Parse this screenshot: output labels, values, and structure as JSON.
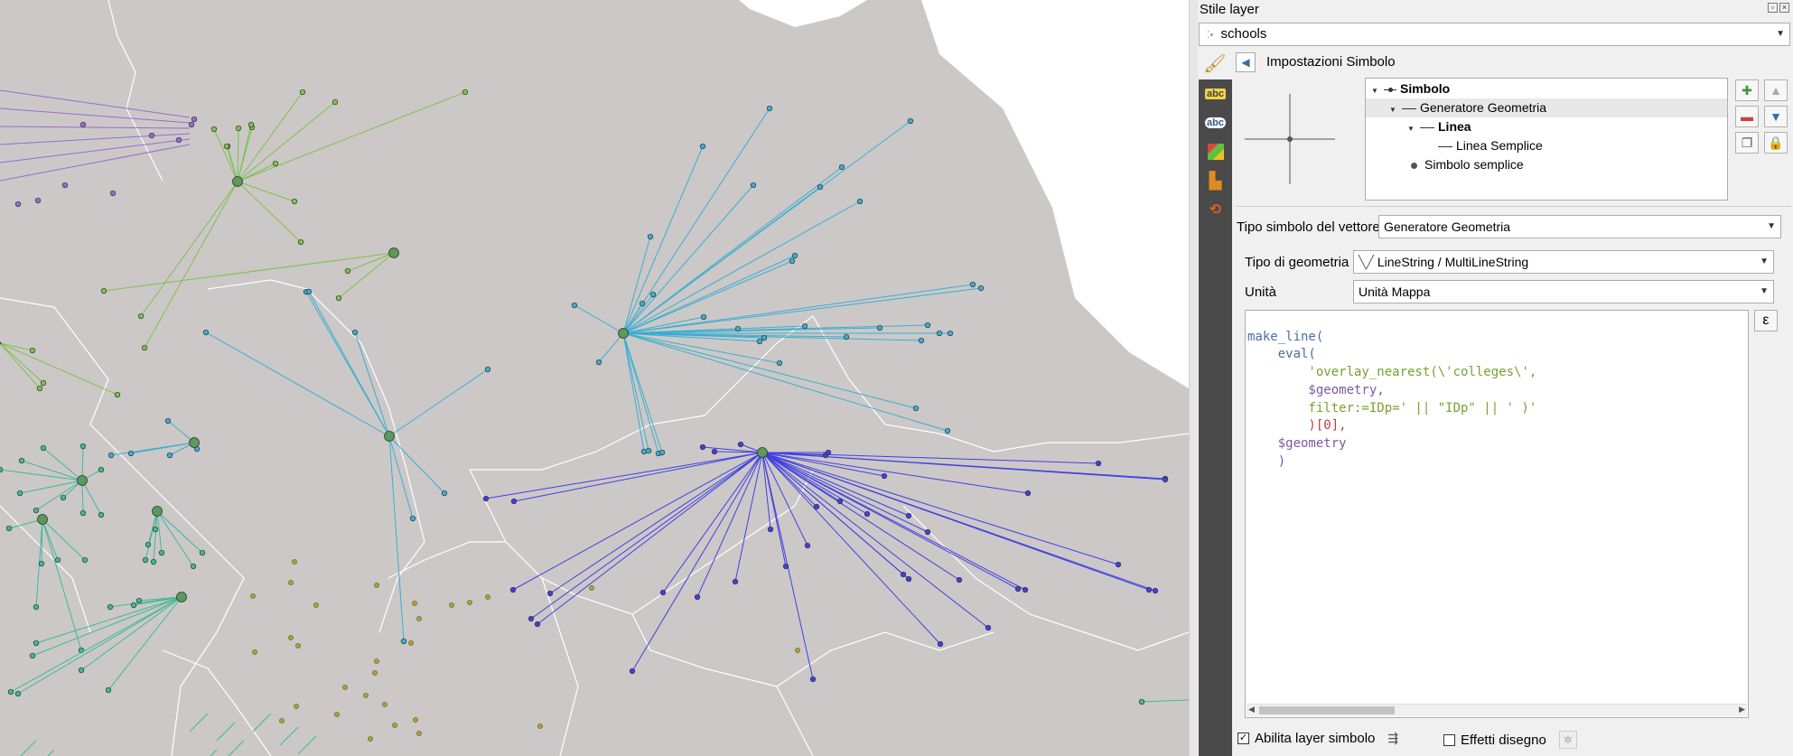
{
  "panel": {
    "title": "Stile layer",
    "layer_name": "schools",
    "subtitle": "Impostazioni Simbolo",
    "tree": {
      "root": "Simbolo",
      "generator": "Generatore Geometria",
      "line": "Linea",
      "simple_line": "Linea Semplice",
      "simple_marker": "Simbolo semplice"
    },
    "vector_type_label": "Tipo simbolo del vettore",
    "vector_type_value": "Generatore Geometria",
    "geometry_type_label": "Tipo di geometria",
    "geometry_type_value": "LineString / MultiLineString",
    "unit_label": "Unità",
    "unit_value": "Unità Mappa",
    "expression_lines": [
      "make_line(",
      "    eval(",
      "        'overlay_nearest(\\'colleges\\',",
      "        $geometry,",
      "        filter:=IDp=' || \"IDp\" || ' )'",
      "        )[0],",
      "    $geometry",
      "    )"
    ],
    "enable_symbol_layer_label": "Abilita layer simbolo",
    "enable_symbol_layer_checked": true,
    "draw_effects_label": "Effetti disegno",
    "draw_effects_checked": false
  },
  "colors": {
    "map_fill": "#ccc8c8",
    "boundary": "#ffffff",
    "purple": "#9a6ad0",
    "green": "#7cc24a",
    "teal": "#3fb898",
    "cyan": "#3aaed0",
    "blue": "#4040e0",
    "yellow": "#b8a020",
    "hub": "#5a9a5a"
  }
}
